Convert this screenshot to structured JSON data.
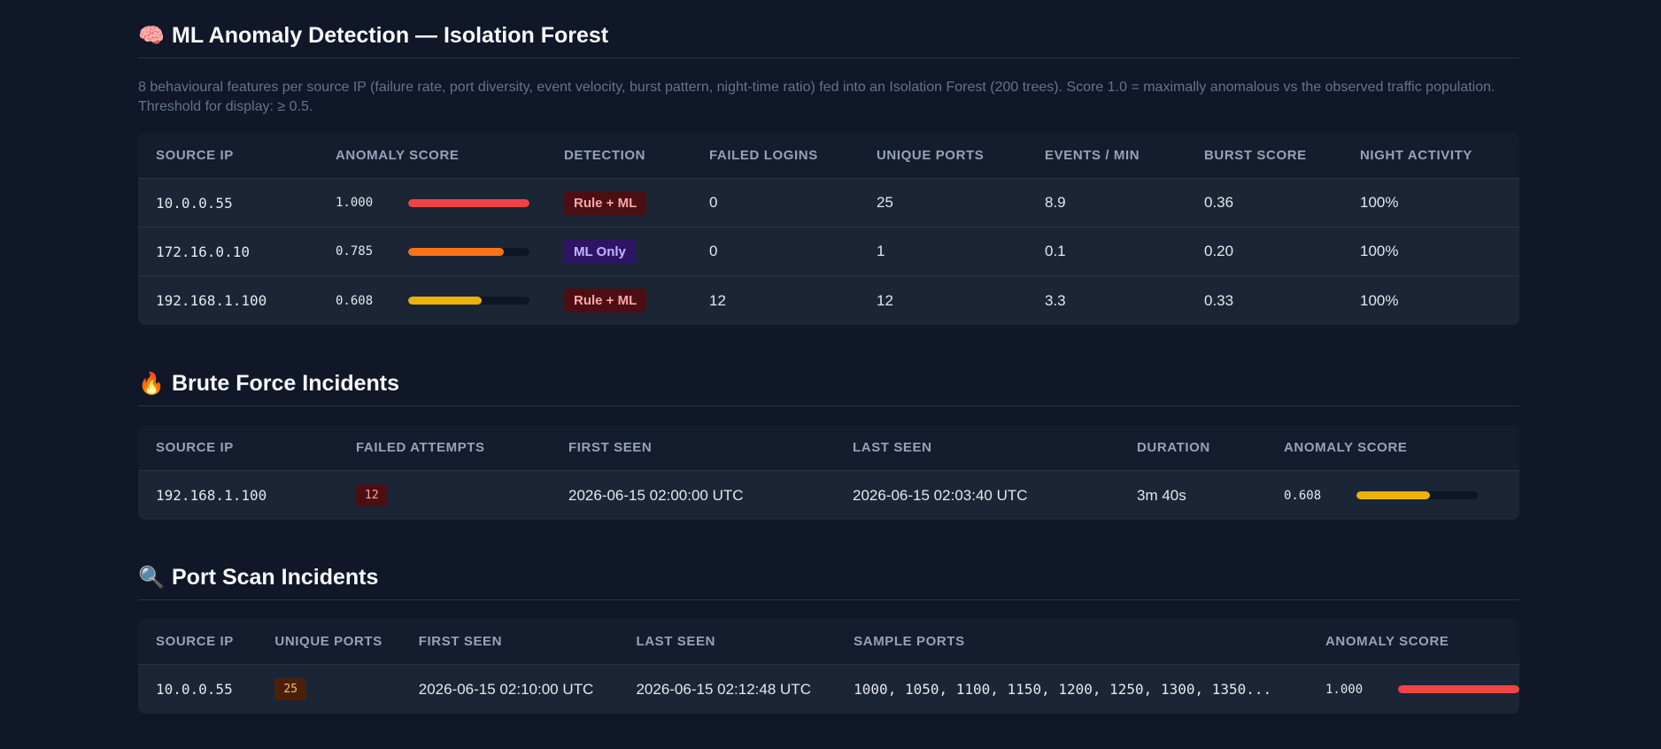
{
  "ml": {
    "icon": "brain-icon",
    "title": "ML Anomaly Detection — Isolation Forest",
    "description": "8 behavioural features per source IP (failure rate, port diversity, event velocity, burst pattern, night-time ratio) fed into an Isolation Forest (200 trees). Score 1.0 = maximally anomalous vs the observed traffic population. Threshold for display: ≥ 0.5.",
    "headers": [
      "SOURCE IP",
      "ANOMALY SCORE",
      "DETECTION",
      "FAILED LOGINS",
      "UNIQUE PORTS",
      "EVENTS / MIN",
      "BURST SCORE",
      "NIGHT ACTIVITY"
    ],
    "rows": [
      {
        "ip": "10.0.0.55",
        "score": "1.000",
        "score_value": 1.0,
        "score_color": "#ef4444",
        "detection": "Rule + ML",
        "detection_type": "rule",
        "failed": "0",
        "ports": "25",
        "epm": "8.9",
        "burst": "0.36",
        "night": "100%"
      },
      {
        "ip": "172.16.0.10",
        "score": "0.785",
        "score_value": 0.785,
        "score_color": "#f97316",
        "detection": "ML Only",
        "detection_type": "ml",
        "failed": "0",
        "ports": "1",
        "epm": "0.1",
        "burst": "0.20",
        "night": "100%"
      },
      {
        "ip": "192.168.1.100",
        "score": "0.608",
        "score_value": 0.608,
        "score_color": "#eab308",
        "detection": "Rule + ML",
        "detection_type": "rule",
        "failed": "12",
        "ports": "12",
        "epm": "3.3",
        "burst": "0.33",
        "night": "100%"
      }
    ]
  },
  "brute": {
    "icon": "fire-icon",
    "title": "Brute Force Incidents",
    "headers": [
      "SOURCE IP",
      "FAILED ATTEMPTS",
      "FIRST SEEN",
      "LAST SEEN",
      "DURATION",
      "ANOMALY SCORE"
    ],
    "rows": [
      {
        "ip": "192.168.1.100",
        "attempts": "12",
        "first": "2026-06-15 02:00:00 UTC",
        "last": "2026-06-15 02:03:40 UTC",
        "duration": "3m 40s",
        "score": "0.608",
        "score_value": 0.608,
        "score_color": "#eab308"
      }
    ]
  },
  "portscan": {
    "icon": "magnifier-icon",
    "title": "Port Scan Incidents",
    "headers": [
      "SOURCE IP",
      "UNIQUE PORTS",
      "FIRST SEEN",
      "LAST SEEN",
      "SAMPLE PORTS",
      "ANOMALY SCORE"
    ],
    "rows": [
      {
        "ip": "10.0.0.55",
        "ports": "25",
        "first": "2026-06-15 02:10:00 UTC",
        "last": "2026-06-15 02:12:48 UTC",
        "sample": "1000, 1050, 1100, 1150, 1200, 1250, 1300, 1350...",
        "score": "1.000",
        "score_value": 1.0,
        "score_color": "#ef4444"
      }
    ]
  }
}
